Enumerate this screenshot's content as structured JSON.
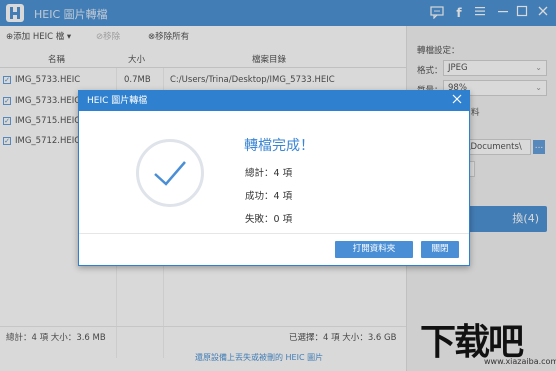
{
  "app": {
    "title": "HEIC 圖片轉檔"
  },
  "toolbar": {
    "add_heic": "添加 HEIC 檔",
    "remove": "移除",
    "remove_all": "移除所有"
  },
  "table": {
    "headers": {
      "name": "名稱",
      "size": "大小",
      "path": "檔案目錄"
    },
    "rows": [
      {
        "name": "IMG_5733.HEIC",
        "size": "0.7MB",
        "path": "C:/Users/Trina/Desktop/IMG_5733.HEIC"
      },
      {
        "name": "IMG_5733.HEIC",
        "size": "",
        "path": ""
      },
      {
        "name": "IMG_5715.HEIC",
        "size": "",
        "path": ""
      },
      {
        "name": "IMG_5712.HEIC",
        "size": "",
        "path": ""
      }
    ]
  },
  "status": {
    "total": "總計：4 項 大小：3.6 MB",
    "selected": "已選擇：4 項 大小：3.6 GB",
    "recover_link": "還原設備上丟失或被刪的 HEIC 圖片"
  },
  "settings": {
    "title": "轉檔設定：",
    "format_label": "格式：",
    "format_value": "JPEG",
    "quality_label": "質量：",
    "quality_value": "98%",
    "exif_fragment": "料",
    "path_value": "na\\Documents\\",
    "path_button": "...",
    "convert_button": "換(4)"
  },
  "dialog": {
    "title": "HEIC 圖片轉檔",
    "heading": "轉檔完成！",
    "total_label": "總計：",
    "total_value": "4 項",
    "success_label": "成功：",
    "success_value": "4 項",
    "fail_label": "失敗：",
    "fail_value": "0 項",
    "open_folder": "打開資料夾",
    "close": "關閉"
  },
  "watermark": {
    "big": "下载吧",
    "small": "www.xiazaiba.com"
  },
  "colors": {
    "accent": "#2f80ce",
    "button": "#4a8fd6",
    "heading": "#3a86d4",
    "panel": "#f1f1f1"
  }
}
